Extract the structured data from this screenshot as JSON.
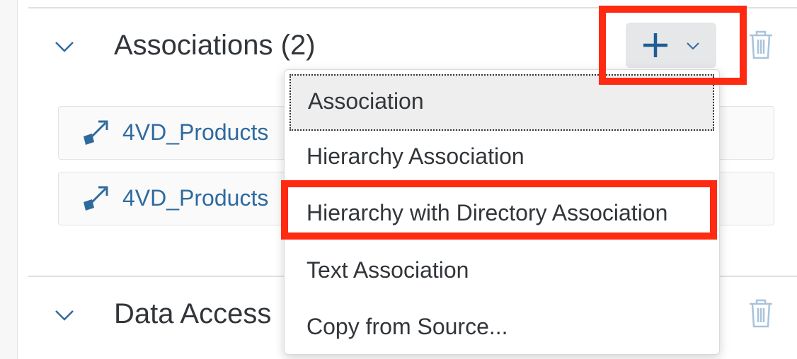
{
  "sections": {
    "associations": {
      "title": "Associations (2)",
      "rows": [
        {
          "label": "4VD_Products"
        },
        {
          "label": "4VD_Products"
        }
      ]
    },
    "data_access": {
      "title": "Data Access"
    }
  },
  "add_menu": {
    "items": [
      {
        "label": "Association"
      },
      {
        "label": "Hierarchy Association"
      },
      {
        "label": "Hierarchy with Directory Association"
      },
      {
        "label": "Text Association"
      },
      {
        "label": "Copy from Source..."
      }
    ]
  },
  "colors": {
    "accent": "#2f6a9f",
    "highlight": "#ff2a12",
    "button_bg": "#e5e7e9"
  },
  "icons": {
    "section_toggle": "chevron-down-icon",
    "add": "plus-icon",
    "dropdown": "chevron-down-icon",
    "delete": "trash-icon",
    "association": "association-link-icon"
  }
}
